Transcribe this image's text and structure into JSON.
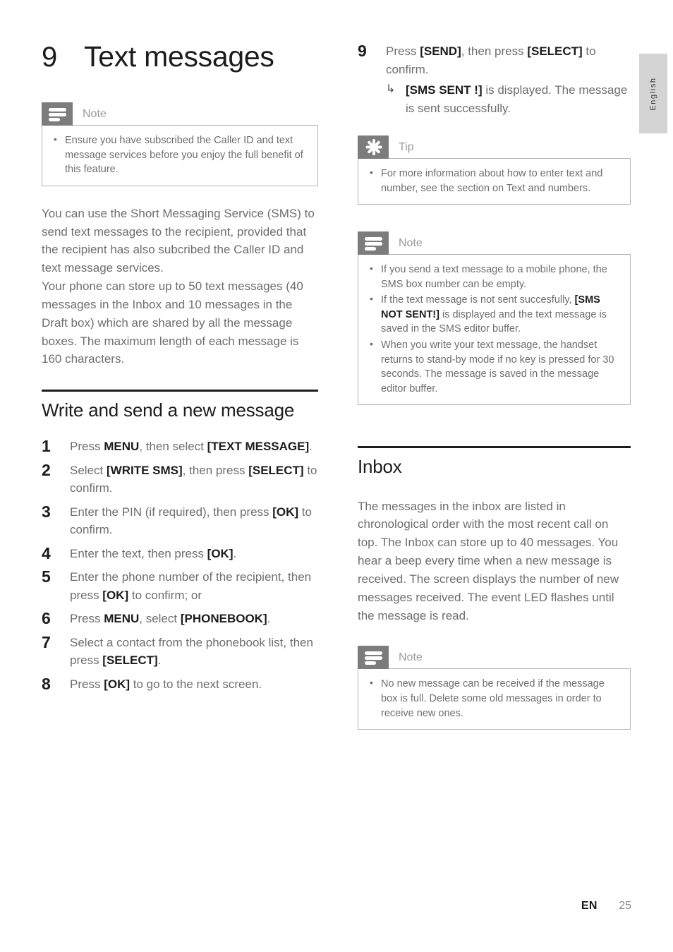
{
  "language_tab": {
    "label": "English"
  },
  "chapter": {
    "number": "9",
    "title": "Text messages"
  },
  "left_column": {
    "note_top": {
      "label": "Note",
      "icon": "note-lines-icon",
      "items": [
        "Ensure you have subscribed the Caller ID and text message services before you enjoy the full benefit of this feature."
      ]
    },
    "intro_paragraphs": [
      "You can use the Short Messaging Service (SMS) to send text messages to the recipient, provided that the recipient has also subcribed the Caller ID and text message services.",
      "Your phone can store up to 50 text messages (40 messages in the Inbox and 10 messages in the Draft box) which are shared by all the message boxes. The maximum length of each message is 160 characters."
    ],
    "section": {
      "title": "Write and send a new message"
    },
    "steps": [
      {
        "number": "1",
        "html": "Press <b>MENU</b>, then select <b>[TEXT MESSAGE]</b>."
      },
      {
        "number": "2",
        "html": "Select <b>[WRITE SMS]</b>, then press <b>[SELECT]</b> to confirm."
      },
      {
        "number": "3",
        "html": "Enter the PIN (if required), then press <b>[OK]</b> to confirm."
      },
      {
        "number": "4",
        "html": "Enter the text, then press <b>[OK]</b>."
      },
      {
        "number": "5",
        "html": "Enter the phone number of the recipient, then press <b>[OK]</b> to confirm; or"
      },
      {
        "number": "6",
        "html": "Press <b>MENU</b>, select <b>[PHONEBOOK]</b>."
      },
      {
        "number": "7",
        "html": "Select a contact from the phonebook list, then press <b>[SELECT]</b>."
      },
      {
        "number": "8",
        "html": "Press <b>[OK]</b> to go to the next screen."
      }
    ]
  },
  "right_column": {
    "step9": {
      "number": "9",
      "html": "Press <b>[SEND]</b>, then press <b>[SELECT]</b> to confirm.",
      "sub_arrow": "↳",
      "sub_html": "<b>[SMS SENT !]</b> is displayed. The message is sent successfully."
    },
    "tip": {
      "label": "Tip",
      "icon": "starburst-icon",
      "items": [
        "For more information about how to enter text and number, see the section on Text and numbers."
      ]
    },
    "note_mid": {
      "label": "Note",
      "icon": "note-lines-icon",
      "items_html": [
        "If you send a text message to a mobile phone, the SMS box number can be empty.",
        "If the text message is not sent succesfully, <b>[SMS NOT SENT!]</b> is displayed and the text message is saved in the SMS editor buffer.",
        "When you write your text message, the handset returns to stand-by mode if no key is pressed for 30 seconds. The message is saved in the message editor buffer."
      ]
    },
    "section": {
      "title": "Inbox"
    },
    "inbox_paragraph": "The messages in the inbox are listed in chronological order with the most recent call on top. The Inbox can store up to 40 messages. You hear a beep every time when a new message is received. The screen displays the number of new messages received. The event LED flashes until the message is read.",
    "note_bottom": {
      "label": "Note",
      "icon": "note-lines-icon",
      "items": [
        "No new message can be received if the message box is full. Delete some old messages in order to receive new ones."
      ]
    }
  },
  "footer": {
    "language_code": "EN",
    "page_number": "25"
  },
  "colors": {
    "body_text": "#6d6e70",
    "heading_text": "#1c1c1c",
    "callout_icon_bg": "#7c7c7c",
    "callout_border": "#b5b5b5",
    "lang_tab_bg": "#d4d4d4"
  }
}
